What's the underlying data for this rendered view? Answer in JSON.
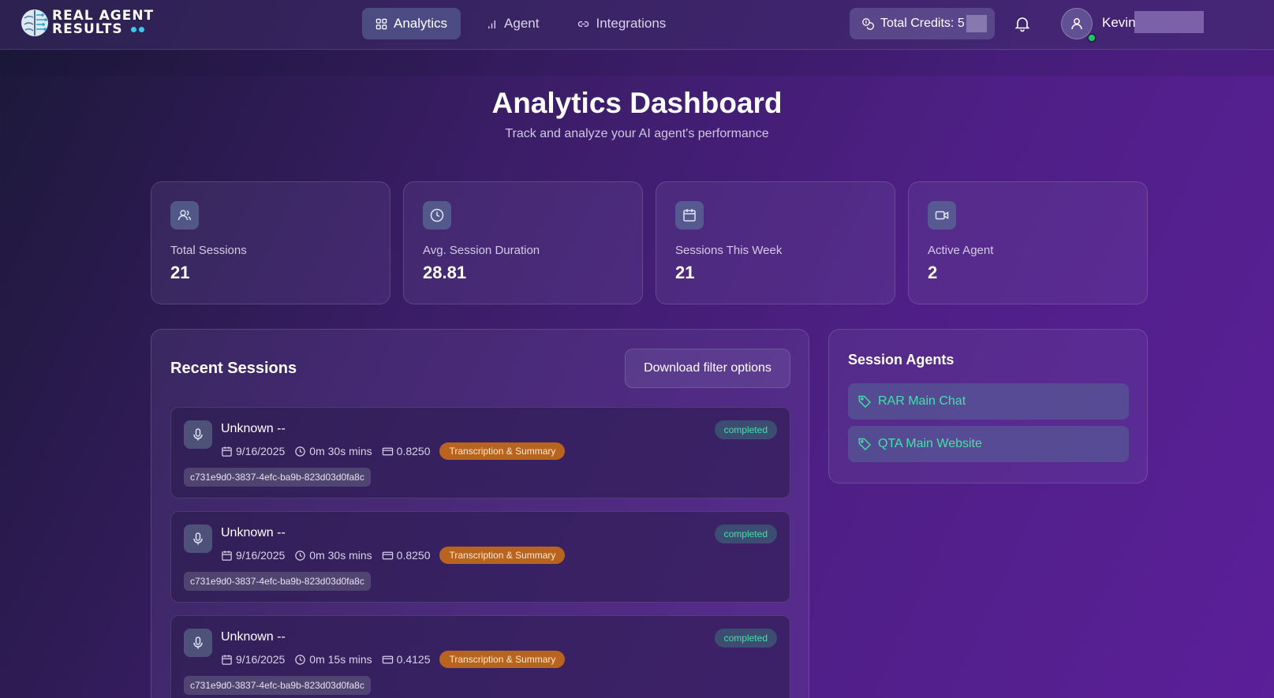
{
  "brand": {
    "line1": "REAL AGENT",
    "line2": "RESULTS"
  },
  "nav": [
    {
      "label": "Analytics",
      "icon": "grid-icon",
      "active": true
    },
    {
      "label": "Agent",
      "icon": "bar-chart-icon",
      "active": false
    },
    {
      "label": "Integrations",
      "icon": "link-icon",
      "active": false
    }
  ],
  "credits": {
    "label": "Total Credits: 5"
  },
  "user": {
    "name": "Kevin"
  },
  "header": {
    "title": "Analytics Dashboard",
    "subtitle": "Track and analyze your AI agent's performance"
  },
  "stats": [
    {
      "label": "Total Sessions",
      "value": "21",
      "icon": "users-icon"
    },
    {
      "label": "Avg. Session Duration",
      "value": "28.81",
      "icon": "clock-icon"
    },
    {
      "label": "Sessions This Week",
      "value": "21",
      "icon": "calendar-icon"
    },
    {
      "label": "Active Agent",
      "value": "2",
      "icon": "video-icon"
    }
  ],
  "recent": {
    "title": "Recent Sessions",
    "download_label": "Download filter options",
    "sessions": [
      {
        "name": "Unknown --",
        "date": "9/16/2025",
        "duration": "0m 30s mins",
        "cost": "0.8250",
        "tag": "Transcription & Summary",
        "status": "completed",
        "id": "c731e9d0-3837-4efc-ba9b-823d03d0fa8c"
      },
      {
        "name": "Unknown --",
        "date": "9/16/2025",
        "duration": "0m 30s mins",
        "cost": "0.8250",
        "tag": "Transcription & Summary",
        "status": "completed",
        "id": "c731e9d0-3837-4efc-ba9b-823d03d0fa8c"
      },
      {
        "name": "Unknown --",
        "date": "9/16/2025",
        "duration": "0m 15s mins",
        "cost": "0.4125",
        "tag": "Transcription & Summary",
        "status": "completed",
        "id": "c731e9d0-3837-4efc-ba9b-823d03d0fa8c"
      }
    ]
  },
  "agents": {
    "title": "Session Agents",
    "items": [
      {
        "label": "RAR Main Chat",
        "icon": "tag-icon"
      },
      {
        "label": "QTA Main Website",
        "icon": "tag-icon"
      }
    ]
  },
  "colors": {
    "accent_green": "#3fe3a6",
    "tag_orange": "#b8641e",
    "online": "#22c55e",
    "logo_dot": "#3ec7e6"
  }
}
